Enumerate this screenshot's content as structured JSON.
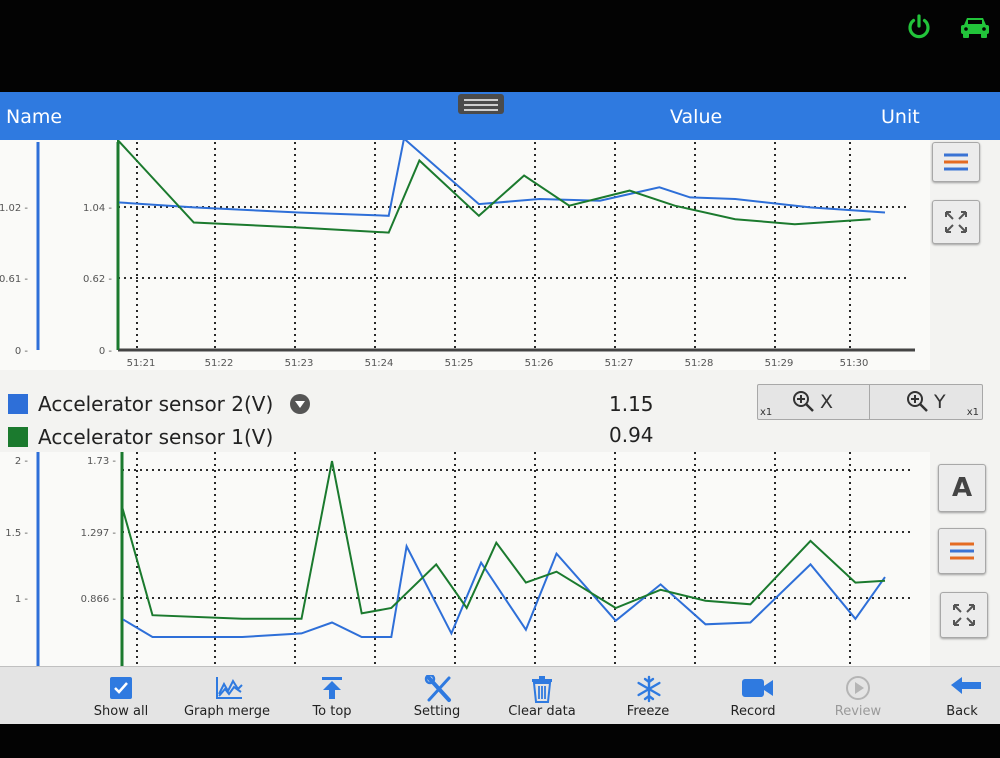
{
  "header": {
    "name_label": "Name",
    "value_label": "Value",
    "unit_label": "Unit"
  },
  "colors": {
    "header": "#2f7ae0",
    "series_blue": "#2e6fd8",
    "series_green": "#1b7a2e",
    "status_icon": "#22c43a"
  },
  "status_icons": [
    "power-icon",
    "car-icon"
  ],
  "legend": [
    {
      "name": "Accelerator sensor 2(V)",
      "value": "1.15",
      "color": "#2e6fd8"
    },
    {
      "name": "Accelerator sensor 1(V)",
      "value": "0.94",
      "color": "#1b7a2e"
    }
  ],
  "zoom": {
    "x_label": "X",
    "y_label": "Y",
    "x_multiplier": "x1",
    "y_multiplier": "x1"
  },
  "side_buttons": {
    "font_label": "A"
  },
  "toolbar": [
    {
      "label": "Show all",
      "icon": "checkbox-icon",
      "enabled": true
    },
    {
      "label": "Graph merge",
      "icon": "graph-merge-icon",
      "enabled": true
    },
    {
      "label": "To top",
      "icon": "to-top-icon",
      "enabled": true
    },
    {
      "label": "Setting",
      "icon": "wrench-screwdriver-icon",
      "enabled": true
    },
    {
      "label": "Clear data",
      "icon": "trash-icon",
      "enabled": true
    },
    {
      "label": "Freeze",
      "icon": "snowflake-icon",
      "enabled": true
    },
    {
      "label": "Record",
      "icon": "video-camera-icon",
      "enabled": true
    },
    {
      "label": "Review",
      "icon": "play-icon",
      "enabled": false
    },
    {
      "label": "Back",
      "icon": "back-arrow-icon",
      "enabled": true
    }
  ],
  "chart_data": [
    {
      "type": "line",
      "x_ticks": [
        "51:21",
        "51:22",
        "51:23",
        "51:24",
        "51:25",
        "51:26",
        "51:27",
        "51:28",
        "51:29",
        "51:30"
      ],
      "xlim": [
        51.133,
        51.983
      ],
      "y_ticks_outer": [
        "1.02",
        "0.61",
        "0"
      ],
      "y_ticks_inner": [
        "1.04",
        "0.62",
        "0"
      ],
      "ylim": [
        0,
        1.24
      ],
      "grid": true,
      "series": [
        {
          "color": "#2e6fd8",
          "x": [
            51.133,
            51.217,
            51.333,
            51.433,
            51.45,
            51.533,
            51.6,
            51.667,
            51.733,
            51.767,
            51.817,
            51.9,
            51.983
          ],
          "y": [
            0.88,
            0.85,
            0.82,
            0.8,
            1.26,
            0.87,
            0.9,
            0.89,
            0.97,
            0.91,
            0.9,
            0.85,
            0.82
          ]
        },
        {
          "color": "#1b7a2e",
          "x": [
            51.133,
            51.133,
            51.217,
            51.333,
            51.433,
            51.467,
            51.533,
            51.583,
            51.633,
            51.7,
            51.75,
            51.817,
            51.883,
            51.967
          ],
          "y": [
            0.0,
            1.25,
            0.76,
            0.73,
            0.7,
            1.13,
            0.8,
            1.04,
            0.86,
            0.95,
            0.86,
            0.78,
            0.75,
            0.78
          ]
        }
      ]
    },
    {
      "type": "line",
      "y_ticks_outer": [
        "2",
        "1.5",
        "1"
      ],
      "y_ticks_inner": [
        "1.73",
        "1.297",
        "0.866"
      ],
      "grid": true,
      "series": [
        {
          "color": "#2e6fd8",
          "x": [
            51.133,
            51.167,
            51.267,
            51.333,
            51.367,
            51.4,
            51.433,
            51.45,
            51.5,
            51.533,
            51.583,
            51.617,
            51.683,
            51.733,
            51.783,
            51.833,
            51.9,
            51.95,
            51.983
          ],
          "y": [
            0.86,
            0.76,
            0.76,
            0.78,
            0.84,
            0.76,
            0.76,
            1.26,
            0.78,
            1.17,
            0.8,
            1.22,
            0.85,
            1.05,
            0.83,
            0.84,
            1.16,
            0.86,
            1.09
          ]
        },
        {
          "color": "#1b7a2e",
          "x": [
            51.133,
            51.133,
            51.167,
            51.267,
            51.333,
            51.367,
            51.4,
            51.433,
            51.483,
            51.517,
            51.55,
            51.583,
            51.617,
            51.683,
            51.733,
            51.783,
            51.833,
            51.9,
            51.95,
            51.983
          ],
          "y": [
            0.0,
            1.48,
            0.88,
            0.86,
            0.86,
            1.73,
            0.89,
            0.92,
            1.16,
            0.92,
            1.28,
            1.06,
            1.12,
            0.92,
            1.02,
            0.96,
            0.94,
            1.29,
            1.06,
            1.07
          ]
        }
      ]
    }
  ]
}
